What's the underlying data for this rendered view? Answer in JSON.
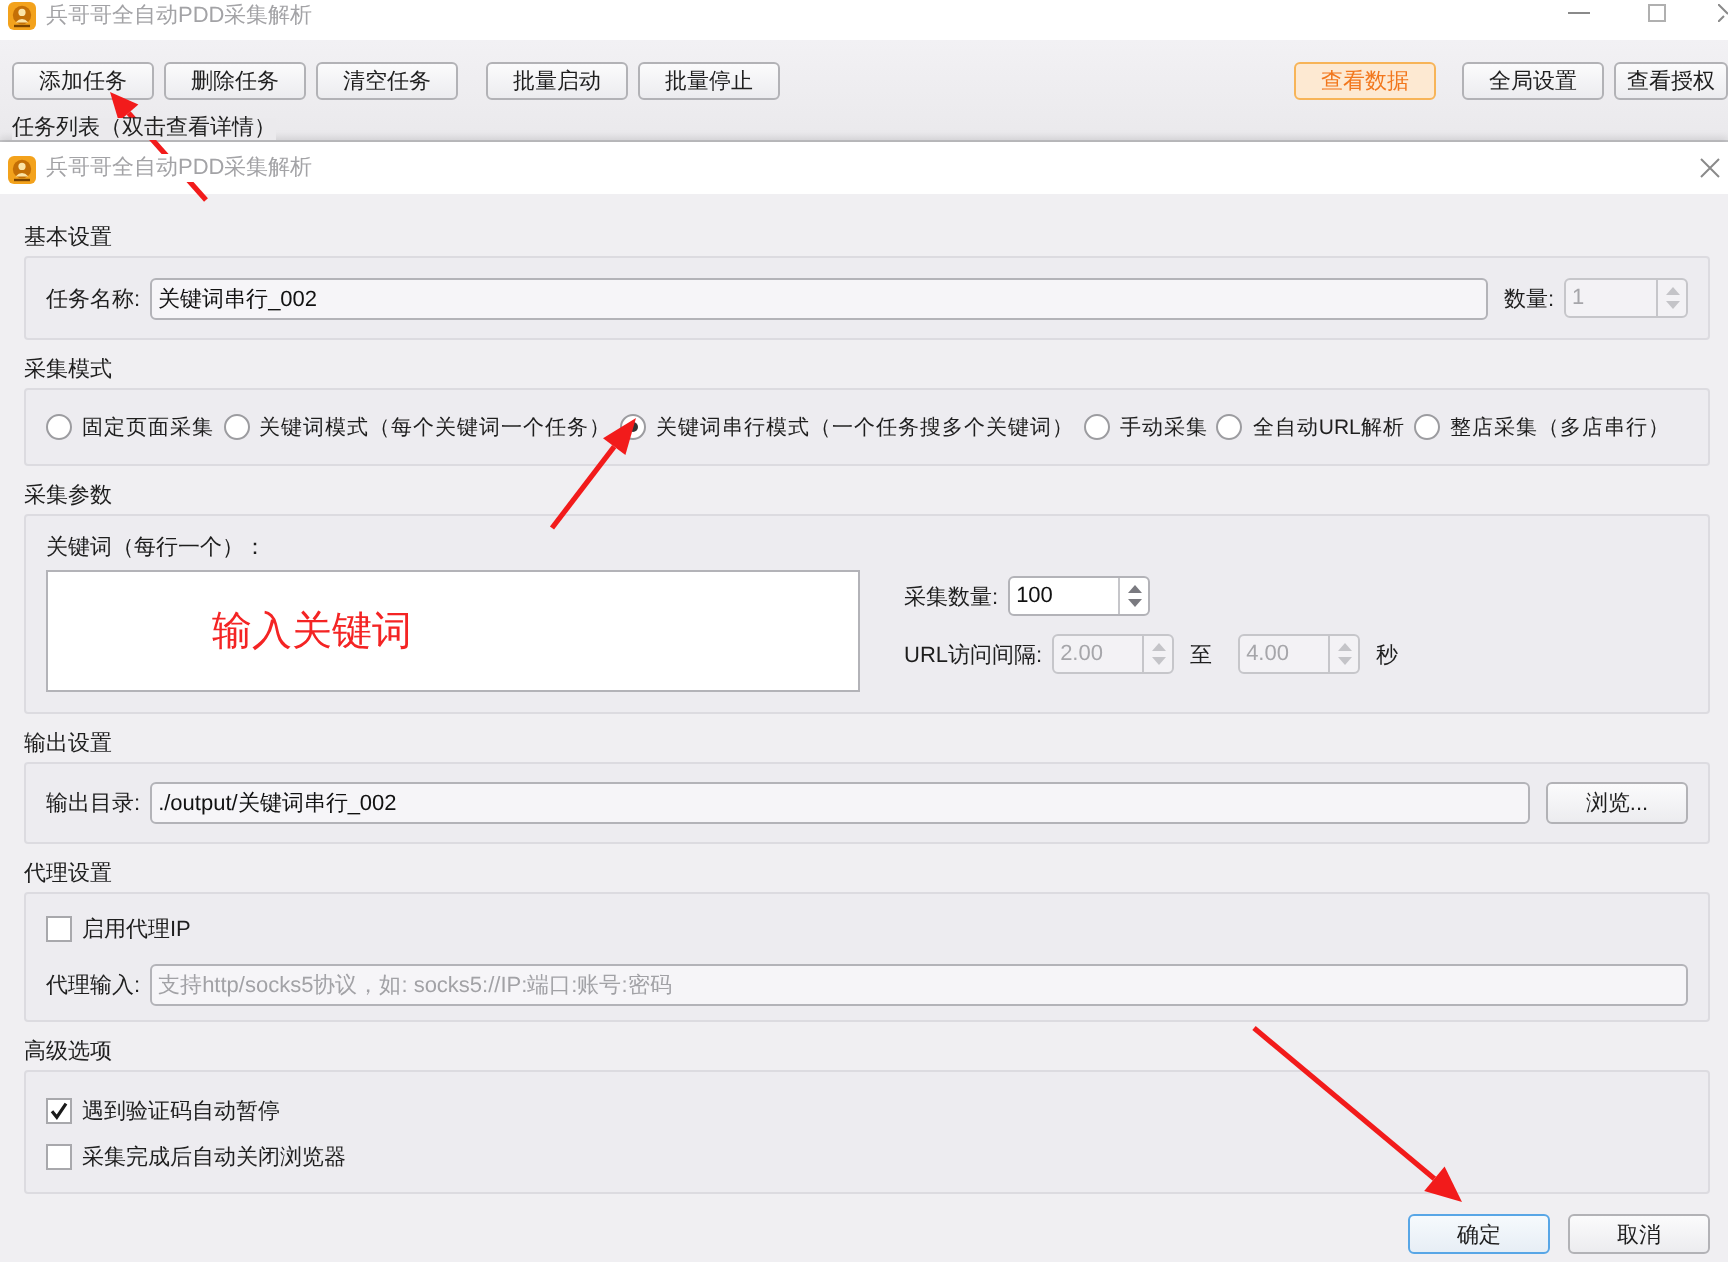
{
  "main_window": {
    "title": "兵哥哥全自动PDD采集解析",
    "toolbar": {
      "left_groups": [
        [
          {
            "label": "添加任务",
            "kind": "normal"
          },
          {
            "label": "删除任务",
            "kind": "normal"
          },
          {
            "label": "清空任务",
            "kind": "normal"
          }
        ],
        [
          {
            "label": "批量启动",
            "kind": "normal"
          },
          {
            "label": "批量停止",
            "kind": "normal"
          }
        ]
      ],
      "right": [
        {
          "label": "查看数据",
          "kind": "highlight"
        },
        {
          "label": "全局设置",
          "kind": "normal"
        },
        {
          "label": "查看授权",
          "kind": "normal"
        }
      ]
    },
    "task_list_label": "任务列表（双击查看详情）"
  },
  "dialog": {
    "title": "兵哥哥全自动PDD采集解析",
    "basic": {
      "heading": "基本设置",
      "name_label": "任务名称:",
      "name_value": "关键词串行_002",
      "count_label": "数量:",
      "count": {
        "value": "1",
        "disabled": true
      }
    },
    "mode": {
      "heading": "采集模式",
      "options": [
        {
          "label": "固定页面采集",
          "selected": false
        },
        {
          "label": "关键词模式（每个关键词一个任务）",
          "selected": false
        },
        {
          "label": "关键词串行模式（一个任务搜多个关键词）",
          "selected": true
        },
        {
          "label": "手动采集",
          "selected": false
        },
        {
          "label": "全自动URL解析",
          "selected": false
        },
        {
          "label": "整店采集（多店串行）",
          "selected": false
        }
      ]
    },
    "params": {
      "heading": "采集参数",
      "keywords_label": "关键词（每行一个）：",
      "collect_count_label": "采集数量:",
      "collect_count": {
        "value": "100",
        "disabled": false
      },
      "interval_label": "URL访问间隔:",
      "interval_min": {
        "value": "2.00",
        "disabled": true
      },
      "interval_to": "至",
      "interval_max": {
        "value": "4.00",
        "disabled": true
      },
      "interval_unit": "秒"
    },
    "output": {
      "heading": "输出设置",
      "dir_label": "输出目录:",
      "dir_value": "./output/关键词串行_002",
      "browse_button": "浏览..."
    },
    "proxy": {
      "heading": "代理设置",
      "enable": {
        "label": "启用代理IP",
        "checked": false
      },
      "input_label": "代理输入:",
      "input_placeholder": "支持http/socks5协议，如: socks5://IP:端口:账号:密码"
    },
    "advanced": {
      "heading": "高级选项",
      "options": [
        {
          "label": "遇到验证码自动暂停",
          "checked": true
        },
        {
          "label": "采集完成后自动关闭浏览器",
          "checked": false
        }
      ]
    },
    "buttons": [
      {
        "label": "确定",
        "focused": true
      },
      {
        "label": "取消",
        "focused": false
      }
    ]
  },
  "annotations": {
    "keyword_hint": "输入关键词"
  }
}
